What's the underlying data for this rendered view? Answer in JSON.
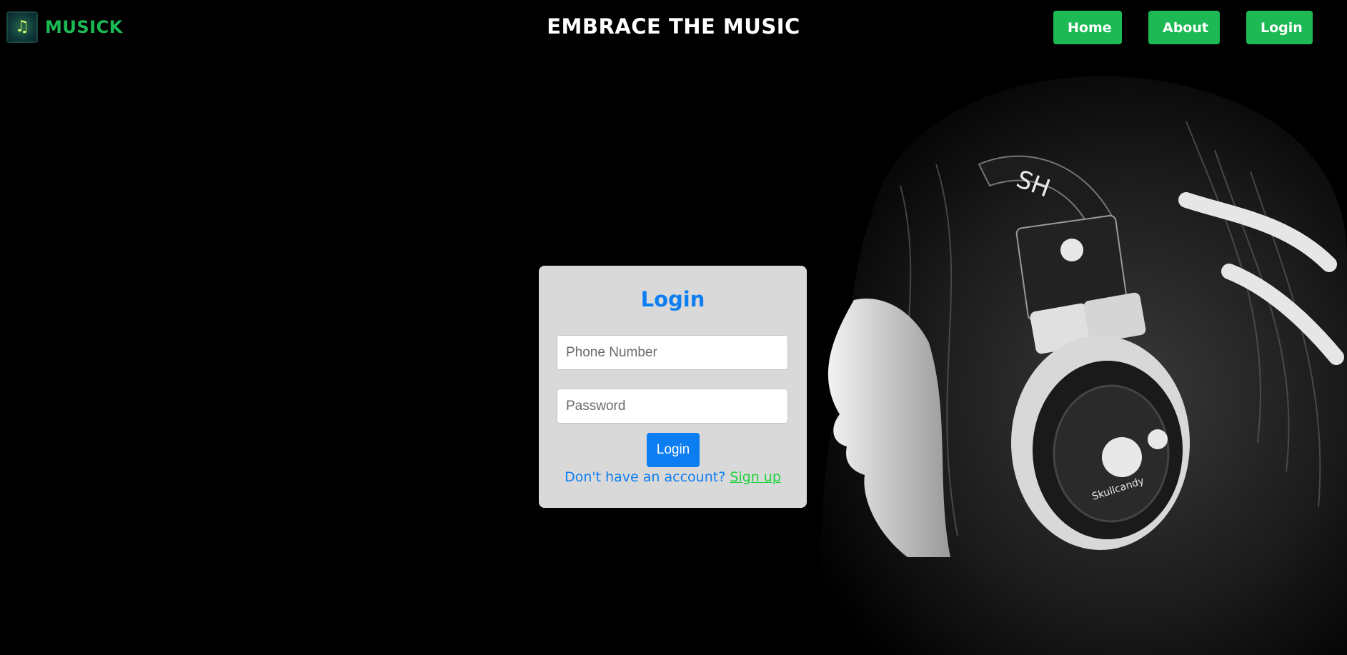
{
  "navbar": {
    "brand_name": "MUSICK",
    "title": "EMBRACE THE MUSIC",
    "links": {
      "home": "Home",
      "about": "About",
      "login": "Login"
    }
  },
  "login_form": {
    "title": "Login",
    "phone_placeholder": "Phone Number",
    "password_placeholder": "Password",
    "submit_label": "Login",
    "signup_prompt": "Don't have an account?",
    "signup_link": "Sign up"
  },
  "icons": {
    "brand_logo": "music-note-icon",
    "background": "headphones-photo"
  },
  "colors": {
    "accent_green": "#1db954",
    "accent_blue": "#0d7ef2",
    "signup_green": "#1dd43a",
    "card_bg": "#d9d9d9",
    "page_bg": "#000000"
  }
}
